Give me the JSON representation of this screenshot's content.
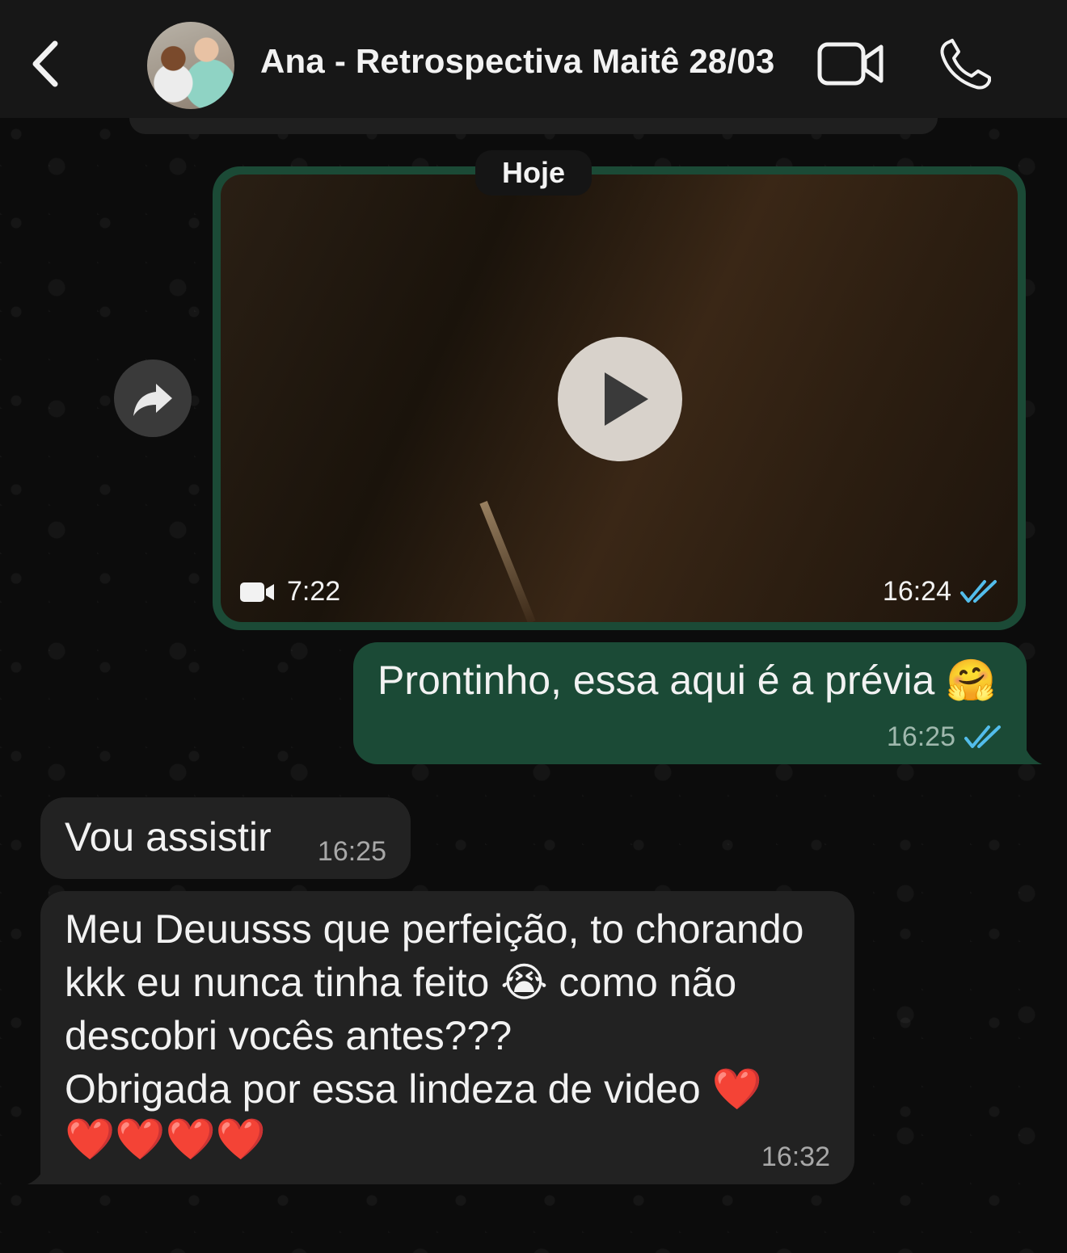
{
  "header": {
    "title": "Ana - Retrospectiva Maitê 28/03",
    "back_icon": "chevron-left-icon",
    "video_call_icon": "video-camera-icon",
    "voice_call_icon": "phone-icon"
  },
  "date_chip": "Hoje",
  "messages": {
    "video": {
      "duration": "7:22",
      "time": "16:24",
      "status": "read"
    },
    "outgoing_text": {
      "text": "Prontinho, essa aqui é a prévia 🤗",
      "time": "16:25",
      "status": "read"
    },
    "incoming_1": {
      "text": "Vou assistir",
      "time": "16:25"
    },
    "incoming_2": {
      "lines": [
        "Meu Deuusss que perfeição, to chorando",
        "kkk eu nunca tinha feito 😭 como não",
        "descobri vocês antes???",
        "Obrigada por essa lindeza de video ❤️",
        "❤️❤️❤️❤️"
      ],
      "time": "16:32"
    }
  },
  "colors": {
    "header_bg": "#171717",
    "outgoing_bubble": "#1b4a36",
    "incoming_bubble": "#222222",
    "read_ticks": "#53bdeb"
  }
}
